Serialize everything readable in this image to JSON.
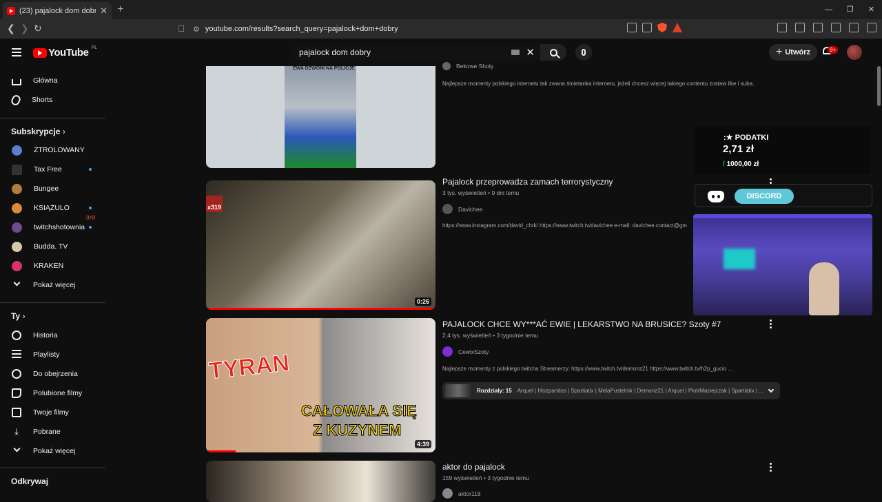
{
  "browser": {
    "tab_title": "(23) pajalock dom dobry - YouTu",
    "url": "youtube.com/results?search_query=pajalock+dom+dobry"
  },
  "header": {
    "logo_text": "YouTube",
    "region": "PL",
    "search_value": "pajalock dom dobry",
    "create_label": "Utwórz",
    "notif_count": "9+"
  },
  "sidebar": {
    "home": "Główna",
    "shorts": "Shorts",
    "subs_title": "Subskrypcje",
    "subs": [
      {
        "name": "ZTROLOWANY",
        "color": "#5a7fd0"
      },
      {
        "name": "Tax Free",
        "color": "#333333"
      },
      {
        "name": "Bungee",
        "color": "#b47c3c"
      },
      {
        "name": "KSIĄŻULO",
        "color": "#e0883a"
      },
      {
        "name": "twitchshotownia",
        "color": "#6b4c8c"
      },
      {
        "name": "Budda. TV",
        "color": "#d7c9a7"
      },
      {
        "name": "KRAKEN",
        "color": "#d6336c"
      }
    ],
    "subs_more": "Pokaż więcej",
    "you_title": "Ty",
    "you_items": [
      "Historia",
      "Playlisty",
      "Do obejrzenia",
      "Polubione filmy",
      "Twoje filmy",
      "Pobrane",
      "Pokaż więcej"
    ],
    "explore_title": "Odkrywaj"
  },
  "results": [
    {
      "thumb_text": "EWA DZWONI NA POLICJE",
      "channel": "Bekowe Shoty",
      "desc": "Najlepsze momenty polskiego internetu tak zwana śmietanka internetu, jeżeli chcesz więcej takiego contentu zostaw like i suba."
    },
    {
      "title": "Pajalock przeprowadza zamach terrorystyczny",
      "meta": "3 tys. wyświetleń • 9 dni temu",
      "channel": "Davichee",
      "desc": "https://www.instagram.com/david_chrk/ https://www.twitch.tv/davichee e-mail: davichee.contact@gm",
      "duration": "0:26",
      "thumb_counter": "x319"
    },
    {
      "title": "PAJALOCK CHCE WY***AĆ EWIE | LEKARSTWO NA BRUSICE? Szoty #7",
      "meta": "2,4 tys. wyświetleń • 3 tygodnie temu",
      "channel": "CewixSzoty",
      "desc": "Najlepsze momenty z polskiego twitcha Streamerzy: https://www.twitch.tv/demonz21 https://www.twitch.tv/h2p_gucio ...",
      "duration": "4:39",
      "thumb_text_1": "TYRAN",
      "thumb_text_2": "CAŁOWAŁA SIĘ",
      "thumb_text_3": "Z KUZYNEM",
      "chapters_label": "Rozdziały: 15",
      "chapters_text": "Arquel | Hiszpanitos | Spartiatix | MelaPustelnik | Demonz21 | Arquel | PiotrMaciejczak | Spartiatix | ..."
    },
    {
      "title": "aktor do pajalock",
      "meta": "159 wyświetleń • 3 tygodnie temu",
      "channel": "aktor118"
    }
  ],
  "overlay": {
    "podatki_title": ":★ PODATKI",
    "podatki_value": "2,71 zł",
    "podatki_goal_slash": "/",
    "podatki_goal": "1000,00 zł",
    "discord_label": "DISCORD"
  },
  "colors": {
    "accent": "#ff0000",
    "bg": "#0f0f0f"
  }
}
